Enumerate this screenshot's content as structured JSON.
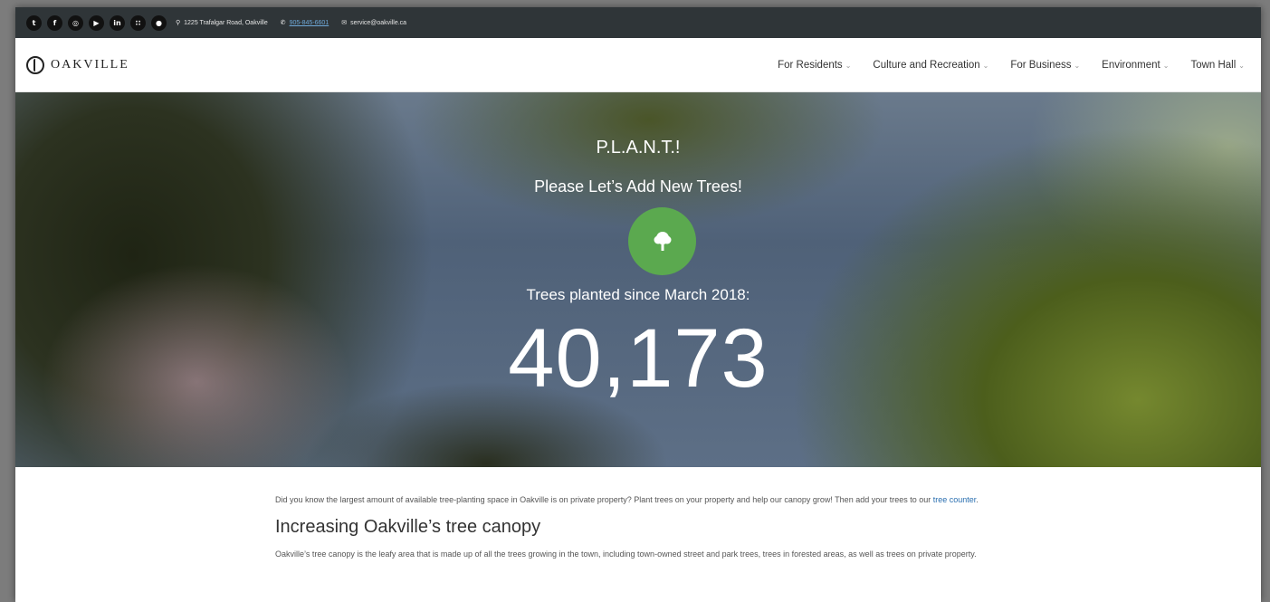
{
  "topbar": {
    "social_icons": [
      {
        "name": "twitter-icon",
        "glyph": "t"
      },
      {
        "name": "facebook-icon",
        "glyph": "f"
      },
      {
        "name": "instagram-icon",
        "glyph": "◎"
      },
      {
        "name": "youtube-icon",
        "glyph": "▶"
      },
      {
        "name": "linkedin-icon",
        "glyph": "in"
      },
      {
        "name": "rss-icon",
        "glyph": "∷"
      },
      {
        "name": "chat-icon",
        "glyph": "●"
      }
    ],
    "address": "1225 Trafalgar Road, Oakville",
    "phone": "905-845-6601",
    "email": "service@oakville.ca"
  },
  "header": {
    "logo_text": "OAKVILLE",
    "nav": [
      {
        "label": "For Residents"
      },
      {
        "label": "Culture and Recreation"
      },
      {
        "label": "For Business"
      },
      {
        "label": "Environment"
      },
      {
        "label": "Town Hall"
      }
    ]
  },
  "hero": {
    "title": "P.L.A.N.T.!",
    "subtitle": "Please Let’s Add New Trees!",
    "badge_icon": "tree-icon",
    "counter_label": "Trees planted since March 2018:",
    "counter_value": "40,173",
    "badge_color": "#5ba94f"
  },
  "content": {
    "intro_text": "Did you know the largest amount of available tree-planting space in Oakville is on private property? Plant trees on your property and help our canopy grow! Then add your trees to our ",
    "intro_link": "tree counter",
    "intro_end": ".",
    "section_title": "Increasing Oakville’s tree canopy",
    "section_body": "Oakville’s tree canopy is the leafy area that is made up of all the trees growing in the town, including town-owned street and park trees, trees in forested areas, as well as trees on private property."
  }
}
